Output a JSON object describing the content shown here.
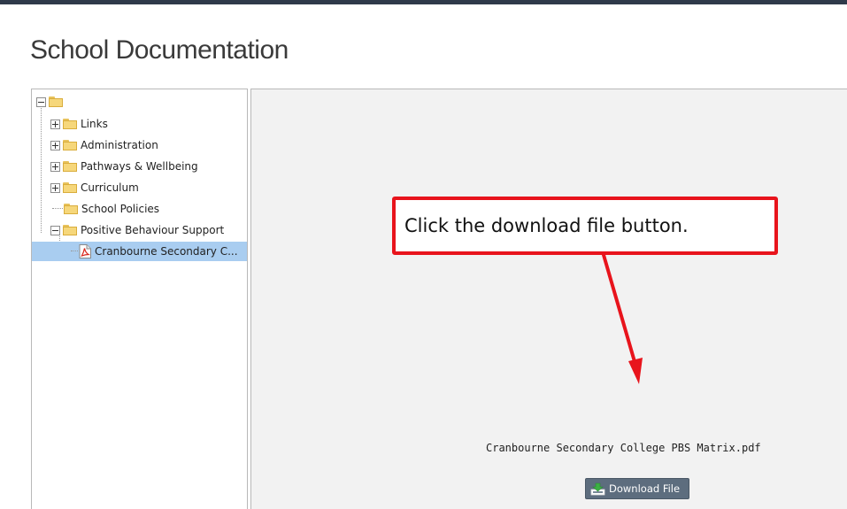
{
  "page": {
    "title": "School Documentation"
  },
  "tree": {
    "root_label": "",
    "items": [
      {
        "label": "Links",
        "expander": "plus",
        "icon": "folder-icon"
      },
      {
        "label": "Administration",
        "expander": "plus",
        "icon": "folder-icon"
      },
      {
        "label": "Pathways & Wellbeing",
        "expander": "plus",
        "icon": "folder-icon"
      },
      {
        "label": "Curriculum",
        "expander": "plus",
        "icon": "folder-icon"
      },
      {
        "label": "School Policies",
        "expander": "none",
        "icon": "folder-icon"
      },
      {
        "label": "Positive Behaviour Support",
        "expander": "minus",
        "icon": "folder-icon"
      }
    ],
    "selected_file": {
      "label": "Cranbourne Secondary C...",
      "icon": "pdf-icon"
    }
  },
  "callout": {
    "text": "Click the download file button.",
    "color": "#e8141c"
  },
  "file": {
    "name": "Cranbourne Secondary College PBS Matrix.pdf"
  },
  "download_button": {
    "label": "Download File",
    "icon": "download-icon",
    "color": "#5d6d7e"
  }
}
